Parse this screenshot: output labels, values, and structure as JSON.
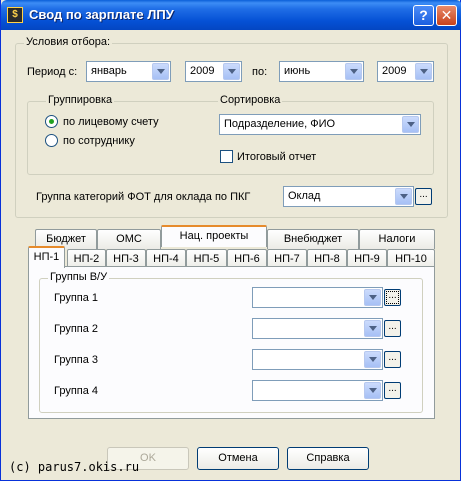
{
  "window": {
    "title": "Свод по зарплате ЛПУ",
    "icon_glyph": "$",
    "help_glyph": "?",
    "close_glyph": "✕"
  },
  "filter": {
    "group_label": "Условия отбора:",
    "period_label": "Период с:",
    "from_month": "январь",
    "from_year": "2009",
    "to_label": "по:",
    "to_month": "июнь",
    "to_year": "2009"
  },
  "grouping": {
    "label": "Группировка",
    "options": [
      "по лицевому счету",
      "по сотруднику"
    ],
    "selected_index": 0
  },
  "sorting": {
    "label": "Сортировка",
    "value": "Подразделение, ФИО",
    "total_report_label": "Итоговый отчет",
    "total_report_checked": false
  },
  "fot": {
    "label": "Группа категорий ФОТ для оклада по ПКГ",
    "value": "Оклад",
    "ellipsis": "..."
  },
  "tabs_row1": [
    "Бюджет",
    "ОМС",
    "Нац. проекты",
    "Внебюджет",
    "Налоги"
  ],
  "tabs_row1_active": 2,
  "tabs_row2": [
    "НП-1",
    "НП-2",
    "НП-3",
    "НП-4",
    "НП-5",
    "НП-6",
    "НП-7",
    "НП-8",
    "НП-9",
    "НП-10"
  ],
  "tabs_row2_active": 0,
  "groups": {
    "label": "Группы В/У",
    "items": [
      "Группа 1",
      "Группа 2",
      "Группа 3",
      "Группа 4"
    ],
    "values": [
      "",
      "",
      "",
      ""
    ],
    "ellipsis": "..."
  },
  "buttons": {
    "ok": "OK",
    "cancel": "Отмена",
    "help": "Справка"
  },
  "watermark": "(c) parus7.okis.ru"
}
